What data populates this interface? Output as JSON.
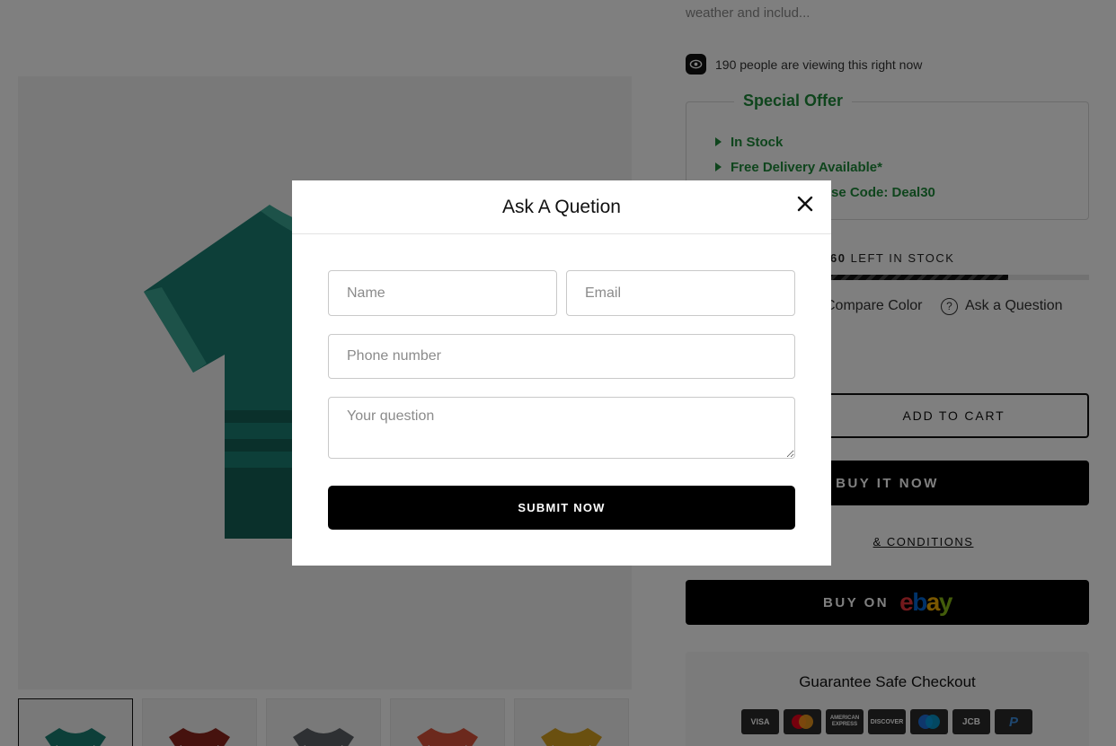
{
  "product": {
    "description_snippet": "weather and includ...",
    "viewers_text": "190 people are viewing this right now",
    "offer": {
      "title": "Special Offer",
      "items": [
        "In Stock",
        "Free Delivery Available*",
        "se Code: Deal30"
      ]
    },
    "stock": {
      "count": "60",
      "suffix": " LEFT IN STOCK",
      "fill_fraction": 0.8
    },
    "links": {
      "compare": "Compare Color",
      "ask": "Ask a Question"
    },
    "add_to_cart_label": "ADD TO CART",
    "buy_now_label": "BUY IT NOW",
    "terms_label": "& CONDITIONS",
    "buy_on_label": "BUY ON",
    "ebay_letters": [
      "e",
      "b",
      "a",
      "y"
    ],
    "checkout_title": "Guarantee Safe Checkout",
    "payment_methods": [
      "VISA",
      "Mastercard",
      "AMERICAN EXPRESS",
      "DISCOVER",
      "Maestro",
      "JCB",
      "PayPal"
    ],
    "shirt_colors": [
      "#1b7e72",
      "#8d241c",
      "#5d6166",
      "#d9533a",
      "#d4a021"
    ]
  },
  "modal": {
    "title": "Ask A Quetion",
    "name_placeholder": "Name",
    "email_placeholder": "Email",
    "phone_placeholder": "Phone number",
    "question_placeholder": "Your question",
    "submit_label": "SUBMIT NOW"
  }
}
